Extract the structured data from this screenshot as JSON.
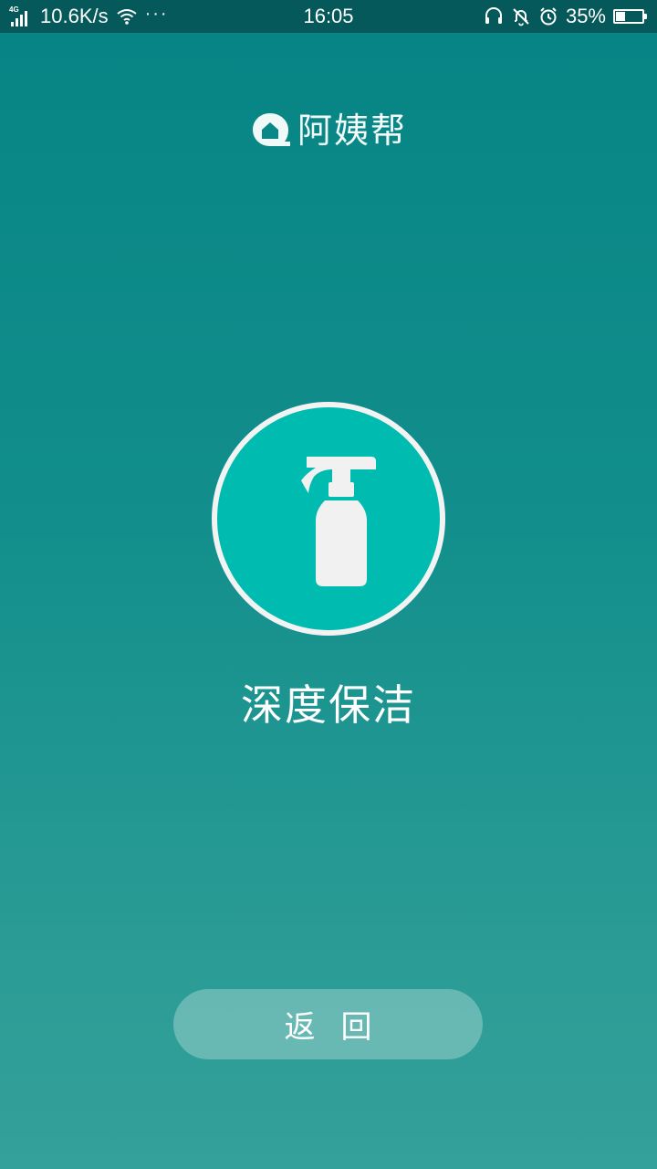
{
  "status_bar": {
    "network_type": "4G",
    "speed": "10.6K/s",
    "more_dots": "···",
    "time": "16:05",
    "battery_percent": "35%",
    "battery_level": 0.35,
    "icons": [
      "signal-icon",
      "wifi-icon",
      "headset-icon",
      "mute-bell-icon",
      "alarm-icon",
      "battery-icon"
    ]
  },
  "logo": {
    "text": "阿姨帮",
    "icon": "home-logo-icon"
  },
  "service": {
    "name": "深度保洁",
    "icon": "spray-bottle-icon",
    "circle_color": "#00bcb0",
    "border_color": "#f3f3f3"
  },
  "back_button": {
    "label": "返回"
  },
  "colors": {
    "status_bar_bg": "#06595a",
    "background_top": "#068485",
    "background_bottom": "#34a19a"
  }
}
